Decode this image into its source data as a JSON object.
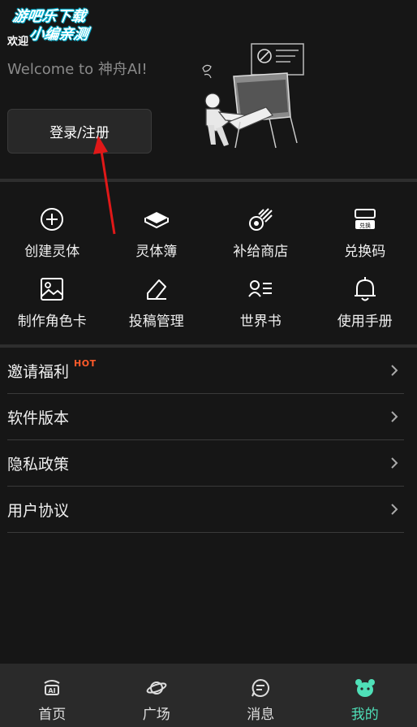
{
  "watermark": {
    "line1": "游吧乐下载",
    "line2": "小编亲测"
  },
  "header": {
    "welcome_small": "欢迎",
    "welcome_big": "Welcome to 神舟AI!",
    "login_label": "登录/注册"
  },
  "features": [
    {
      "label": "创建灵体",
      "icon": "plus-circle-icon"
    },
    {
      "label": "灵体簿",
      "icon": "book-icon"
    },
    {
      "label": "补给商店",
      "icon": "meteor-icon"
    },
    {
      "label": "兑换码",
      "icon": "redeem-card-icon",
      "icon_text": "兑换"
    },
    {
      "label": "制作角色卡",
      "icon": "image-card-icon"
    },
    {
      "label": "投稿管理",
      "icon": "edit-icon"
    },
    {
      "label": "世界书",
      "icon": "user-list-icon"
    },
    {
      "label": "使用手册",
      "icon": "bell-icon"
    }
  ],
  "menu": [
    {
      "label": "邀请福利",
      "badge": "HOT"
    },
    {
      "label": "软件版本"
    },
    {
      "label": "隐私政策"
    },
    {
      "label": "用户协议"
    }
  ],
  "tabs": [
    {
      "label": "首页",
      "icon": "home-icon"
    },
    {
      "label": "广场",
      "icon": "planet-icon"
    },
    {
      "label": "消息",
      "icon": "message-icon"
    },
    {
      "label": "我的",
      "icon": "mine-icon",
      "active": true
    }
  ],
  "colors": {
    "background": "#161616",
    "accent": "#4fe0b8",
    "hot": "#ff5a2a",
    "arrow": "#e01818"
  }
}
